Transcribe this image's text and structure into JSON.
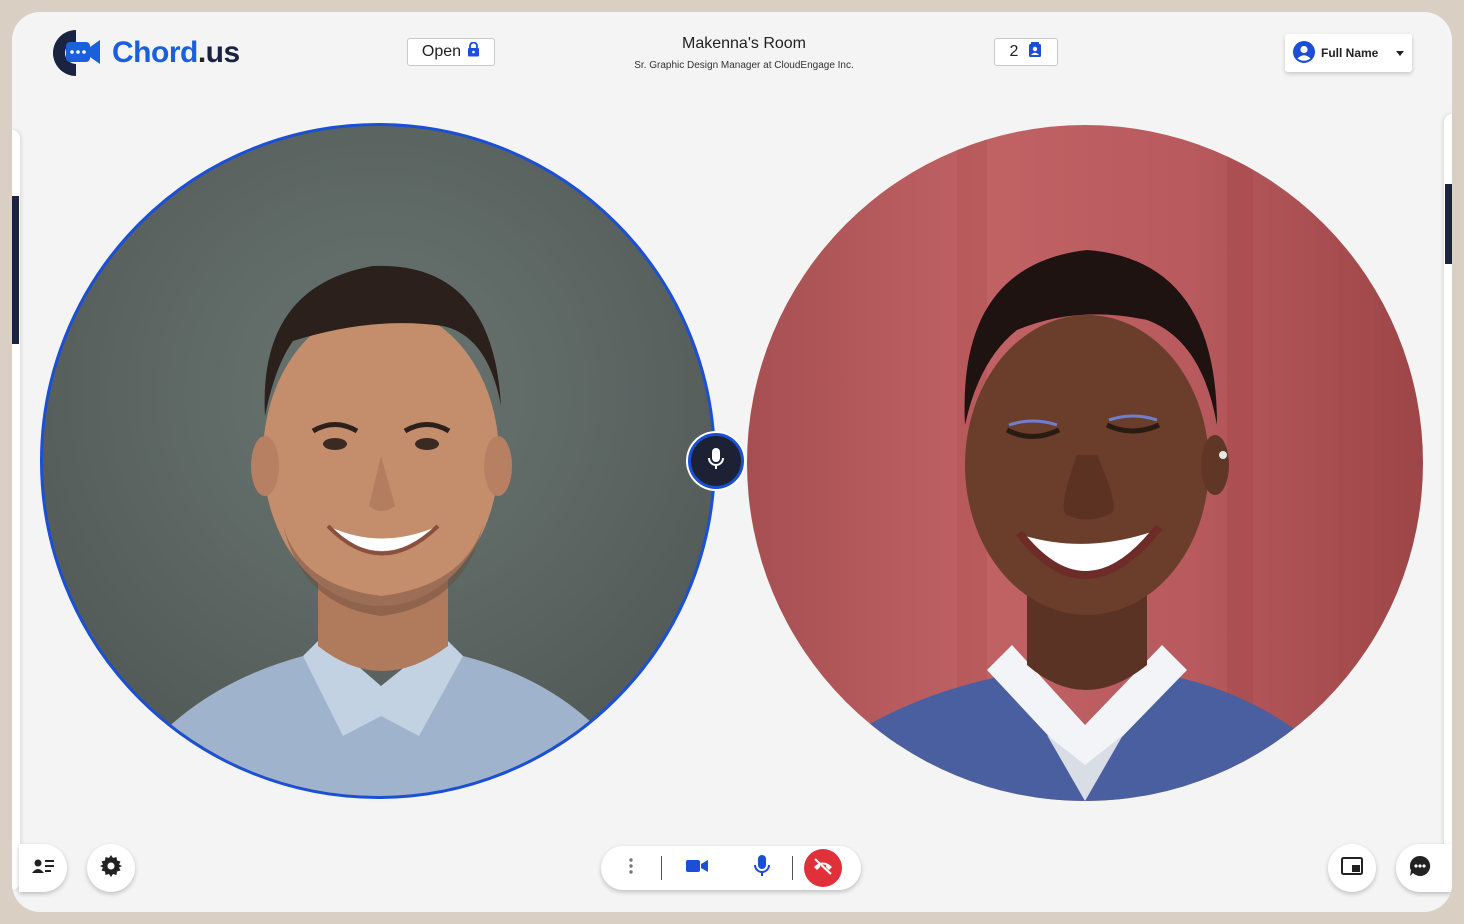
{
  "brand": {
    "name_main": "Chord",
    "name_dot": ".",
    "name_tld": "us",
    "color": "#1a5fdb"
  },
  "header": {
    "lock_label": "Open",
    "room_title": "Makenna's Room",
    "room_subtitle": "Sr. Graphic Design Manager at CloudEngage Inc.",
    "participant_count": "2",
    "user_name": "Full Name"
  },
  "icons": {
    "lock": "lock-icon",
    "participants": "contacts-icon",
    "user": "account-circle-icon",
    "mic": "mic-icon",
    "camera": "videocam-icon",
    "end_call": "call-end-icon",
    "more": "more-vert-icon",
    "settings": "gear-icon",
    "pip": "picture-in-picture-icon",
    "chat": "chat-bubble-icon",
    "people_list": "people-list-icon"
  },
  "colors": {
    "accent": "#1a4fd6",
    "end_call": "#e0313a",
    "dark": "#1a2340"
  }
}
